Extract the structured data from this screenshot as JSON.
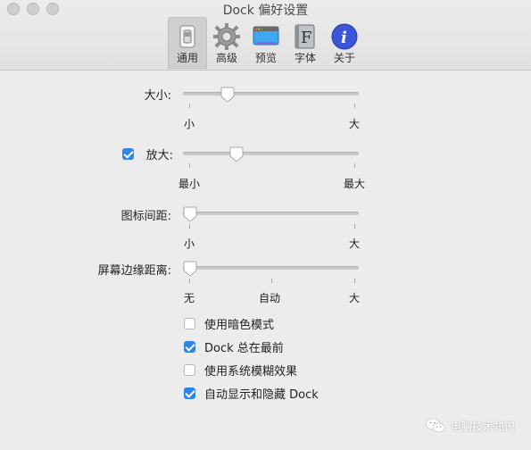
{
  "window": {
    "title": "Dock 偏好设置"
  },
  "toolbar": {
    "tabs": [
      {
        "label": "通用",
        "icon": "general-switch-icon",
        "selected": true
      },
      {
        "label": "高级",
        "icon": "gear-icon",
        "selected": false
      },
      {
        "label": "预览",
        "icon": "preview-window-icon",
        "selected": false
      },
      {
        "label": "字体",
        "icon": "font-book-icon",
        "selected": false
      },
      {
        "label": "关于",
        "icon": "info-icon",
        "selected": false
      }
    ]
  },
  "settings": {
    "size": {
      "label": "大小:",
      "min_label": "小",
      "max_label": "大",
      "value": 0.16
    },
    "magnification": {
      "checked": true,
      "label": "放大:",
      "min_label": "最小",
      "max_label": "最大",
      "value": 0.3
    },
    "icon_spacing": {
      "label": "图标间距:",
      "min_label": "小",
      "max_label": "大",
      "value": 0.0
    },
    "screen_edge_distance": {
      "label": "屏幕边缘距离:",
      "min_label": "无",
      "mid_label": "自动",
      "max_label": "大",
      "value": 0.0
    }
  },
  "options": [
    {
      "label": "使用暗色模式",
      "checked": false
    },
    {
      "label": "Dock 总在最前",
      "checked": true
    },
    {
      "label": "使用系统模糊效果",
      "checked": false
    },
    {
      "label": "自动显示和隐藏 Dock",
      "checked": true
    }
  ],
  "watermark": {
    "text": "电脑技术知识",
    "icon": "wechat-icon"
  },
  "colors": {
    "accent": "#2f86e8",
    "window_bg": "#ececec",
    "selected_tab": "#cfcfcf"
  }
}
